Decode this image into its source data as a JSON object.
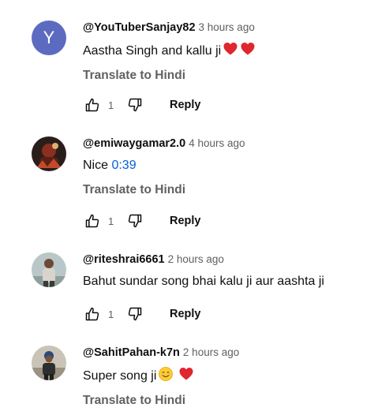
{
  "comments": [
    {
      "author": "@YouTuberSanjay82",
      "time": "3 hours ago",
      "avatar_letter": "Y",
      "text": "Aastha Singh and kallu ji",
      "translate_label": "Translate to Hindi",
      "likes": "1",
      "reply_label": "Reply"
    },
    {
      "author": "@emiwaygamar2.0",
      "time": "4 hours ago",
      "text": "Nice ",
      "timestamp_link": "0:39",
      "translate_label": "Translate to Hindi",
      "likes": "1",
      "reply_label": "Reply"
    },
    {
      "author": "@riteshrai6661",
      "time": "2 hours ago",
      "text": "Bahut sundar song bhai kalu ji aur aashta ji",
      "likes": "1",
      "reply_label": "Reply"
    },
    {
      "author": "@SahitPahan-k7n",
      "time": "2 hours ago",
      "text": "Super song ji",
      "translate_label": "Translate to Hindi"
    }
  ],
  "colors": {
    "avatar_bg": "#5c6bc0",
    "link": "#065fd4",
    "muted": "#606060",
    "heart": "#e0262e"
  }
}
